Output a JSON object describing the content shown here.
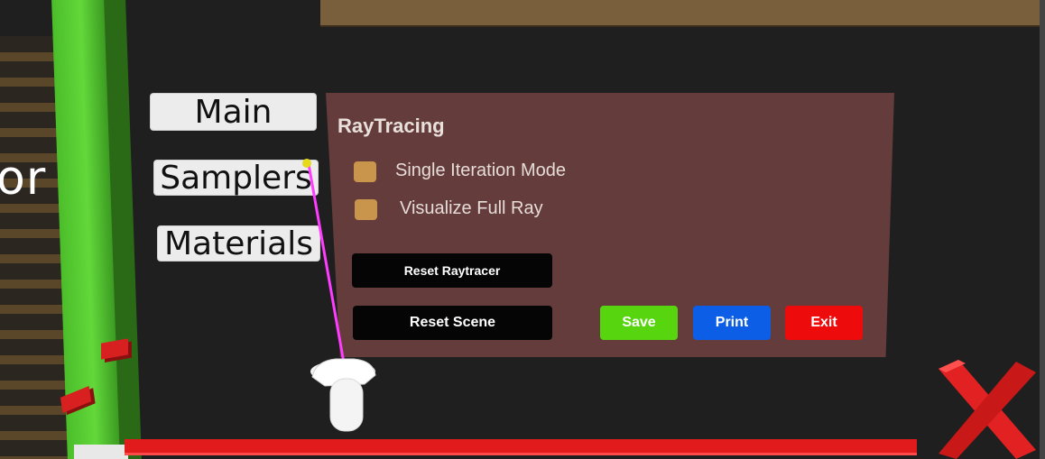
{
  "wall": {
    "text": "or"
  },
  "menu": {
    "tabs": [
      {
        "label": "Main"
      },
      {
        "label": "Samplers"
      },
      {
        "label": "Materials"
      }
    ]
  },
  "panel": {
    "title": "RayTracing",
    "options": [
      {
        "label": "Single Iteration Mode",
        "checked": false
      },
      {
        "label": "Visualize Full Ray",
        "checked": false
      }
    ],
    "buttons": {
      "reset_raytracer": "Reset Raytracer",
      "reset_scene": "Reset Scene",
      "save": "Save",
      "print": "Print",
      "exit": "Exit"
    }
  },
  "icons": {
    "controller": "vr-controller-icon",
    "close": "red-x-icon"
  },
  "colors": {
    "panel": "#643c3c",
    "checkbox": "#c9944c",
    "save": "#57d610",
    "print": "#0c5ee6",
    "exit": "#ee0b0b",
    "laser": "#ff3cff"
  }
}
